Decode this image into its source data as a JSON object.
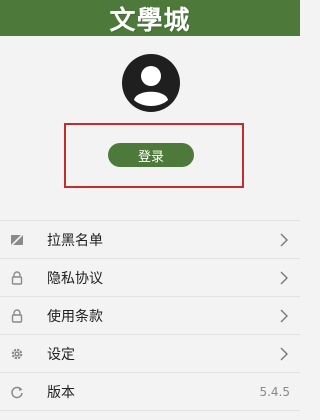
{
  "header": {
    "logo_text": "文學城",
    "bg_color": "#4d7a3a"
  },
  "profile": {
    "avatar_icon": "user-avatar-icon",
    "login_label": "登录"
  },
  "colors": {
    "accent": "#4d7a3a",
    "highlight": "#c22c2c"
  },
  "menu": {
    "items": [
      {
        "label": "拉黑名单",
        "icon": "block-list-icon"
      },
      {
        "label": "隐私协议",
        "icon": "lock-icon"
      },
      {
        "label": "使用条款",
        "icon": "lock-icon"
      },
      {
        "label": "设定",
        "icon": "gear-icon"
      },
      {
        "label": "版本",
        "icon": "refresh-icon",
        "value": "5.4.5"
      }
    ]
  }
}
